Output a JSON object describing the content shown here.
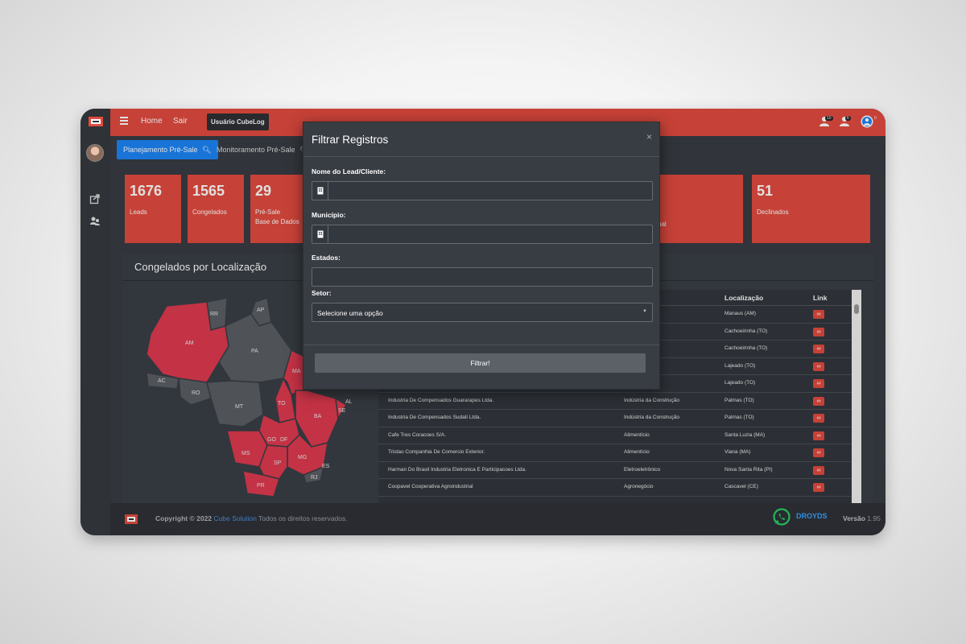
{
  "topbar": {
    "home_label": "Home",
    "logout_label": "Sair",
    "user_chip": "Usuário CubeLog",
    "badge_1": "10",
    "badge_2": "6",
    "badge_3": "0"
  },
  "tabs": {
    "active_label": "Planejamento Pré-Sale",
    "second_label": "Monitoramento Pré-Sale"
  },
  "cards": [
    {
      "number": "1676",
      "label_line1": "Leads",
      "label_line2": ""
    },
    {
      "number": "1565",
      "label_line1": "Congelados",
      "label_line2": ""
    },
    {
      "number": "29",
      "label_line1": "Pré-Sale",
      "label_line2": "Base de Dados"
    },
    {
      "number": "",
      "label_line1": "ual",
      "label_line2": ""
    },
    {
      "number": "51",
      "label_line1": "Declinados",
      "label_line2": ""
    }
  ],
  "panel": {
    "title": "Congelados por Localização"
  },
  "map": {
    "highlight_color": "#e03a4f",
    "other_color": "#5a5e64",
    "states": [
      "RR",
      "AP",
      "AM",
      "PA",
      "MA",
      "AC",
      "RO",
      "MT",
      "TO",
      "BA",
      "SE",
      "AL",
      "GO",
      "DF",
      "MG",
      "ES",
      "MS",
      "SP",
      "RJ",
      "PR"
    ]
  },
  "table": {
    "headers": {
      "localizacao": "Localização",
      "link": "Link"
    },
    "rows": [
      {
        "nome": "",
        "setor": "",
        "local": "Manaus (AM)"
      },
      {
        "nome": "",
        "setor": "onstrução",
        "local": "Cachoeirinha (TO)"
      },
      {
        "nome": "",
        "setor": "onstrução",
        "local": "Cachoeirinha (TO)"
      },
      {
        "nome": "",
        "setor": "",
        "local": "Lajeado (TO)"
      },
      {
        "nome": "",
        "setor": "",
        "local": "Lajeado (TO)"
      },
      {
        "nome": "Industria De Compensados Guararapes Ltda.",
        "setor": "Indústria da Construção",
        "local": "Palmas (TO)"
      },
      {
        "nome": "Industria De Compensados Sudati Ltda.",
        "setor": "Indústria da Construção",
        "local": "Palmas (TO)"
      },
      {
        "nome": "Cafe Tres Coracoes S/A.",
        "setor": "Alimentício",
        "local": "Santa Luzia (MA)"
      },
      {
        "nome": "Tristao Companhia De Comercio Exterior.",
        "setor": "Alimentício",
        "local": "Viana (MA)"
      },
      {
        "nome": "Harman Do Brasil Industria Eletronica E Participacoes Ltda.",
        "setor": "Eletroeletrônico",
        "local": "Nova Santa Rita (PI)"
      },
      {
        "nome": "Coopavel Cooperativa Agroindustrial",
        "setor": "Agronegócio",
        "local": "Cascavel (CE)"
      }
    ]
  },
  "footer": {
    "copyright_prefix": "Copyright © 2022",
    "brand": "Cube Solution",
    "suffix": "Todos os direitos reservados.",
    "droids": "DROYDS",
    "version_label": "Versão",
    "version_number": "1.95"
  },
  "modal": {
    "title": "Filtrar Registros",
    "close": "×",
    "field_lead_label": "Nome do Lead/Cliente:",
    "field_municipio_label": "Município:",
    "field_estados_label": "Estados:",
    "field_setor_label": "Setor:",
    "setor_value": "Selecione uma opção",
    "submit_label": "Filtrar!"
  },
  "colors": {
    "accent": "#e24b3f",
    "primary_blue": "#1d84f6",
    "bg_dark": "#383c43"
  }
}
